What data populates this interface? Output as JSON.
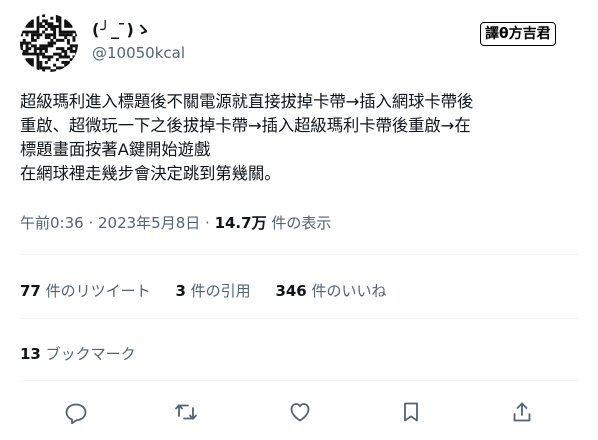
{
  "author": {
    "display_name": "(╯_ ̄)ゝ",
    "handle": "@10050kcal"
  },
  "watermark": {
    "text": "譯θ方吉君"
  },
  "tweet": {
    "lines": [
      "超級瑪利進入標題後不關電源就直接拔掉卡帶→插入網球卡帶後",
      "重啟、超微玩一下之後拔掉卡帶→插入超級瑪利卡帶後重啟→在",
      "標題畫面按著A鍵開始遊戲",
      "在網球裡走幾步會決定跳到第幾關。"
    ]
  },
  "meta": {
    "timestamp": "午前0:36 · 2023年5月8日",
    "separator": " · ",
    "views_count": "14.7万",
    "views_label": " 件の表示"
  },
  "stats": {
    "retweets_count": "77",
    "retweets_label": " 件のリツイート",
    "quotes_count": "3",
    "quotes_label": " 件の引用",
    "likes_count": "346",
    "likes_label": " 件のいいね"
  },
  "bookmarks": {
    "count": "13",
    "label": " ブックマーク"
  },
  "actions": [
    "reply-icon",
    "retweet-icon",
    "like-icon",
    "bookmark-icon",
    "share-icon"
  ],
  "colors": {
    "text": "#0f1419",
    "secondary": "#536471",
    "divider": "#eff3f4"
  }
}
